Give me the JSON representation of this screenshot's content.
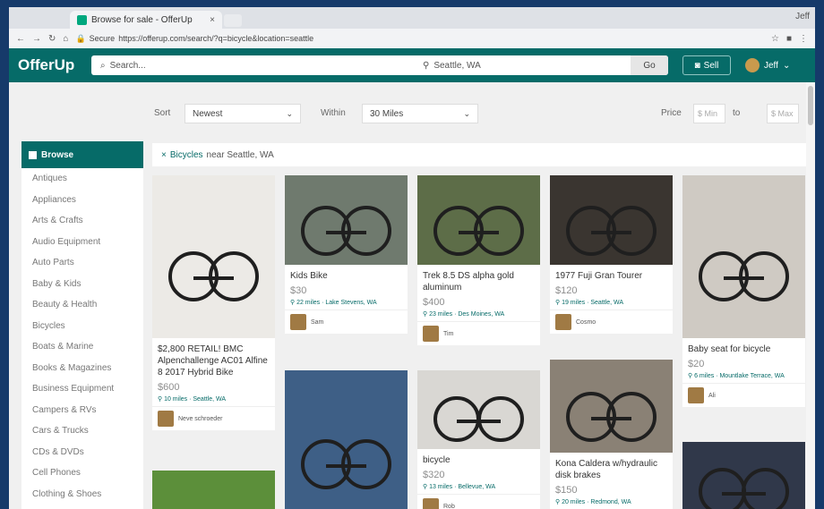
{
  "browser": {
    "tab_title": "Browse for sale - OfferUp",
    "tab_close": "×",
    "profile": "Jeff",
    "url": "https://offerup.com/search/?q=bicycle&location=seattle",
    "secure_label": "Secure"
  },
  "header": {
    "logo": "OfferUp",
    "search_placeholder": "Search...",
    "location": "Seattle, WA",
    "go_label": "Go",
    "sell_label": "Sell",
    "user_name": "Jeff"
  },
  "filters": {
    "sort_label": "Sort",
    "sort_value": "Newest",
    "within_label": "Within",
    "within_value": "30 Miles",
    "price_label": "Price",
    "min_placeholder": "$ Min",
    "to_label": "to",
    "max_placeholder": "$ Max"
  },
  "sidebar": {
    "title": "Browse",
    "categories": [
      "Antiques",
      "Appliances",
      "Arts & Crafts",
      "Audio Equipment",
      "Auto Parts",
      "Baby & Kids",
      "Beauty & Health",
      "Bicycles",
      "Boats & Marine",
      "Books & Magazines",
      "Business Equipment",
      "Campers & RVs",
      "Cars & Trucks",
      "CDs & DVDs",
      "Cell Phones",
      "Clothing & Shoes"
    ]
  },
  "breadcrumb": {
    "remove": "×",
    "keyword": "Bicycles",
    "near": "near Seattle, WA"
  },
  "listings": [
    {
      "title": "$2,800 RETAIL! BMC Alpenchallenge AC01 Alfine 8 2017 Hybrid Bike",
      "price": "$600",
      "location": "10 miles · Seattle, WA",
      "seller": "Neve schroeder",
      "photo_bg": "#eceae6"
    },
    {
      "title": "",
      "price": "",
      "location": "",
      "seller": "",
      "photo_bg": "#5c8f3a"
    },
    {
      "title": "Kids Bike",
      "price": "$30",
      "location": "22 miles · Lake Stevens, WA",
      "seller": "Sam",
      "photo_bg": "#6f7a6e"
    },
    {
      "title": "",
      "price": "",
      "location": "",
      "seller": "",
      "photo_bg": "#3e5f86"
    },
    {
      "title": "Trek 8.5 DS alpha gold aluminum",
      "price": "$400",
      "location": "23 miles · Des Moines, WA",
      "seller": "Tim",
      "photo_bg": "#5d6d48"
    },
    {
      "title": "bicycle",
      "price": "$320",
      "location": "13 miles · Bellevue, WA",
      "seller": "Rob",
      "photo_bg": "#d9d7d3"
    },
    {
      "title": "1977 Fuji Gran Tourer",
      "price": "$120",
      "location": "19 miles · Seattle, WA",
      "seller": "Cosmo",
      "photo_bg": "#3a3530"
    },
    {
      "title": "Kona Caldera w/hydraulic disk brakes",
      "price": "$150",
      "location": "20 miles · Redmond, WA",
      "seller": "",
      "photo_bg": "#8a8175"
    },
    {
      "title": "Baby seat for bicycle",
      "price": "$20",
      "location": "6 miles · Mountlake Terrace, WA",
      "seller": "Ali",
      "photo_bg": "#cfcac3"
    },
    {
      "title": "",
      "price": "",
      "location": "",
      "seller": "",
      "photo_bg": "#30384a"
    }
  ]
}
